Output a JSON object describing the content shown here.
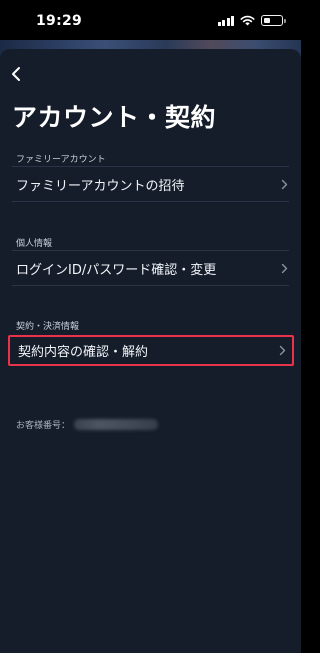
{
  "status_bar": {
    "time": "19:29",
    "icons": [
      "signal-icon",
      "wifi-icon",
      "battery-icon"
    ]
  },
  "header": {
    "back_icon": "chevron-left-icon",
    "title": "アカウント・契約"
  },
  "sections": [
    {
      "header": "ファミリーアカウント",
      "items": [
        {
          "label": "ファミリーアカウントの招待",
          "icon": "chevron-right-icon"
        }
      ]
    },
    {
      "header": "個人情報",
      "items": [
        {
          "label": "ログインID/パスワード確認・変更",
          "icon": "chevron-right-icon"
        }
      ]
    },
    {
      "header": "契約・決済情報",
      "items": [
        {
          "label": "契約内容の確認・解約",
          "icon": "chevron-right-icon",
          "highlighted": true
        }
      ]
    }
  ],
  "customer_number": {
    "label": "お客様番号："
  },
  "colors": {
    "background": "#151d2b",
    "highlight_border": "#e8334a",
    "divider": "#2a3446"
  }
}
